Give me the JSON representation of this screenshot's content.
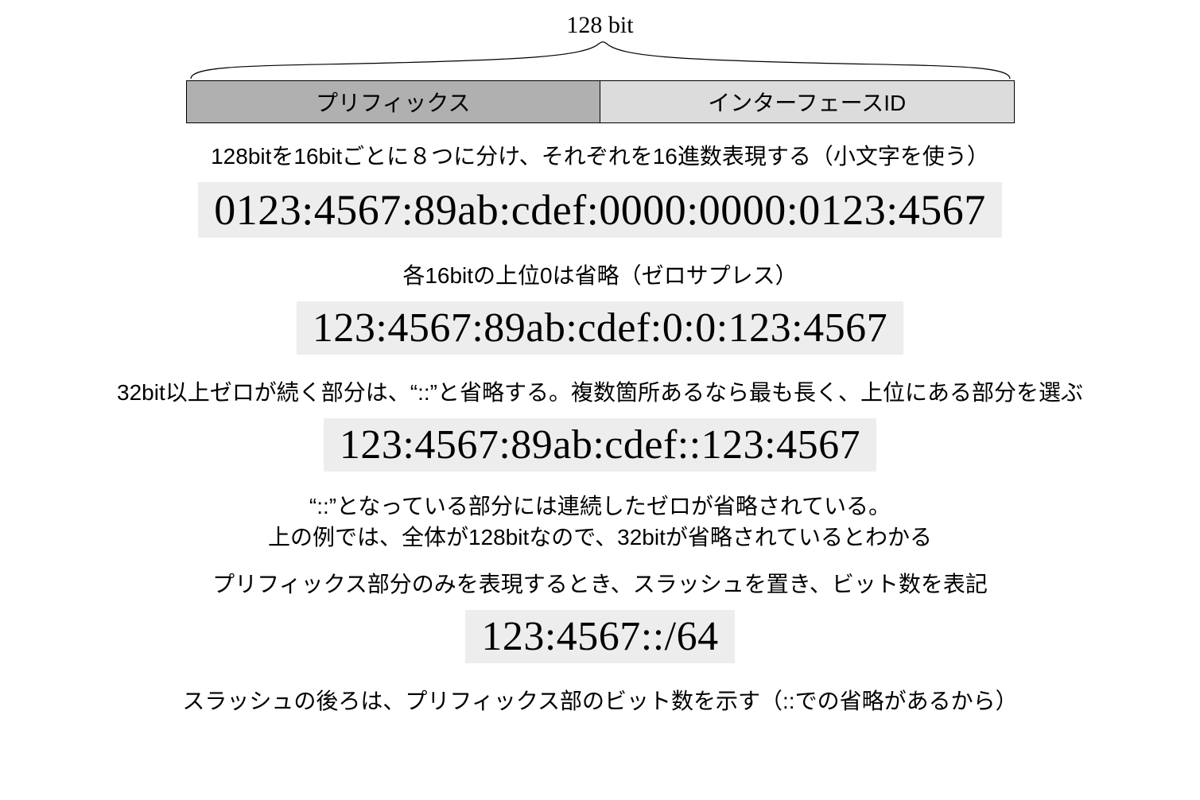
{
  "title_bits": "128 bit",
  "bar": {
    "prefix": "プリフィックス",
    "interface_id": "インターフェースID"
  },
  "step1": {
    "desc": "128bitを16bitごとに８つに分け、それぞれを16進数表現する（小文字を使う）",
    "code": "0123:4567:89ab:cdef:0000:0000:0123:4567"
  },
  "step2": {
    "desc": "各16bitの上位0は省略（ゼロサプレス）",
    "code": "123:4567:89ab:cdef:0:0:123:4567"
  },
  "step3": {
    "desc": "32bit以上ゼロが続く部分は、“::”と省略する。複数箇所あるなら最も長く、上位にある部分を選ぶ",
    "code": "123:4567:89ab:cdef::123:4567"
  },
  "step4": {
    "desc1": "“::”となっている部分には連続したゼロが省略されている。",
    "desc2": "上の例では、全体が128bitなので、32bitが省略されているとわかる",
    "desc3": "プリフィックス部分のみを表現するとき、スラッシュを置き、ビット数を表記",
    "code": "123:4567::/64",
    "desc4": "スラッシュの後ろは、プリフィックス部のビット数を示す（::での省略があるから）"
  }
}
